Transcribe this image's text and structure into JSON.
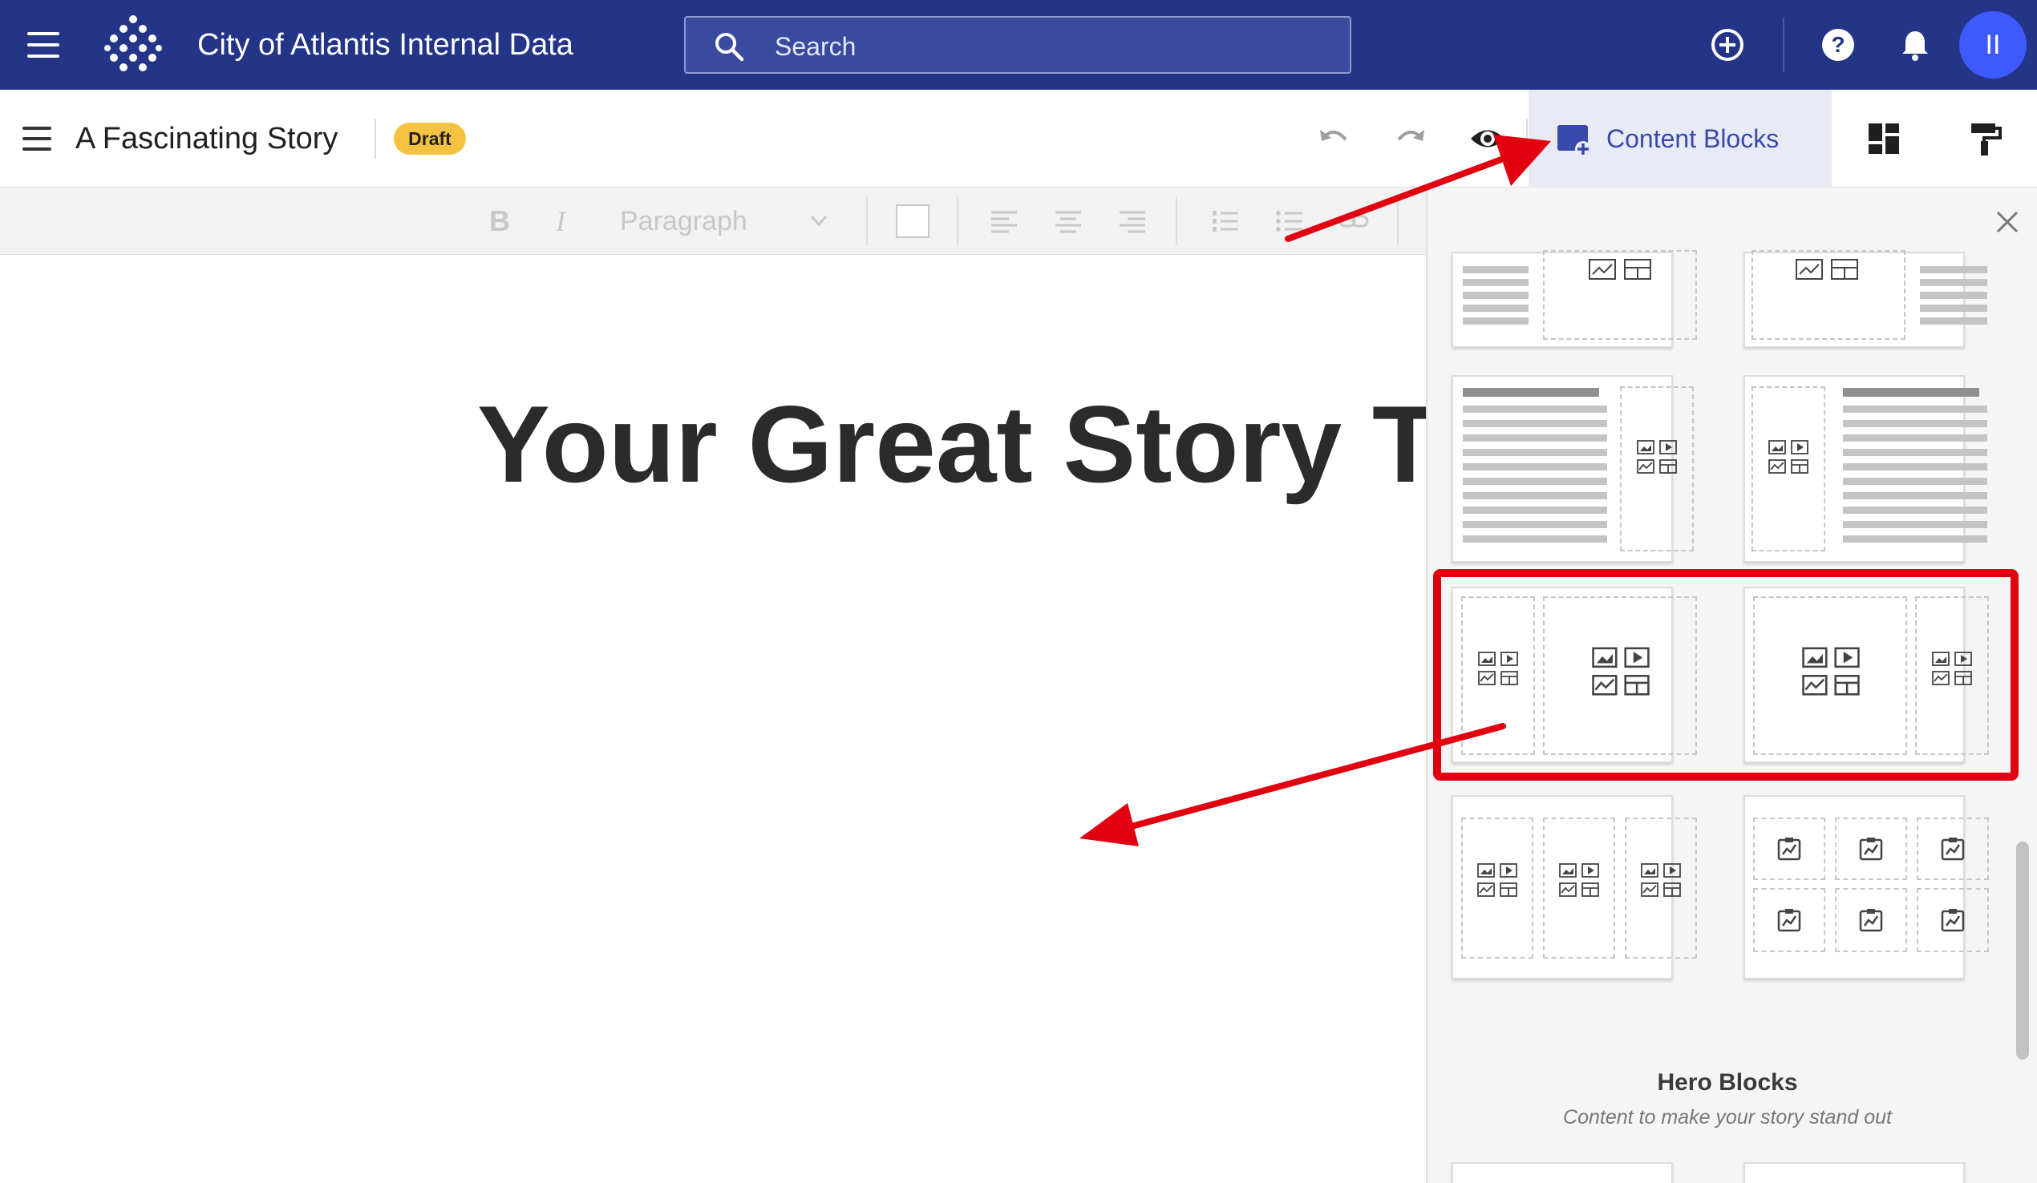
{
  "topbar": {
    "menu_icon": "hamburger-icon",
    "logo_icon": "dots-logo-icon",
    "title": "City of Atlantis Internal Data",
    "search_placeholder": "Search",
    "icons": [
      "add-circle-icon",
      "help-icon",
      "bell-icon"
    ],
    "avatar_initials": "II",
    "color": "#243487"
  },
  "story": {
    "title": "A Fascinating Story",
    "status_badge": "Draft",
    "toolbar_icons": [
      "undo-icon",
      "redo-icon",
      "preview-eye-icon",
      "layout-icon",
      "paint-roller-icon"
    ],
    "content_blocks_label": "Content Blocks",
    "heading": "Your Great Story T"
  },
  "formatting": {
    "bold": "B",
    "italic": "I",
    "paragraph_select": "Paragraph"
  },
  "panel": {
    "hero_title": "Hero Blocks",
    "hero_subtitle": "Content to make your story stand out"
  },
  "annotation_color": "#e0000f"
}
